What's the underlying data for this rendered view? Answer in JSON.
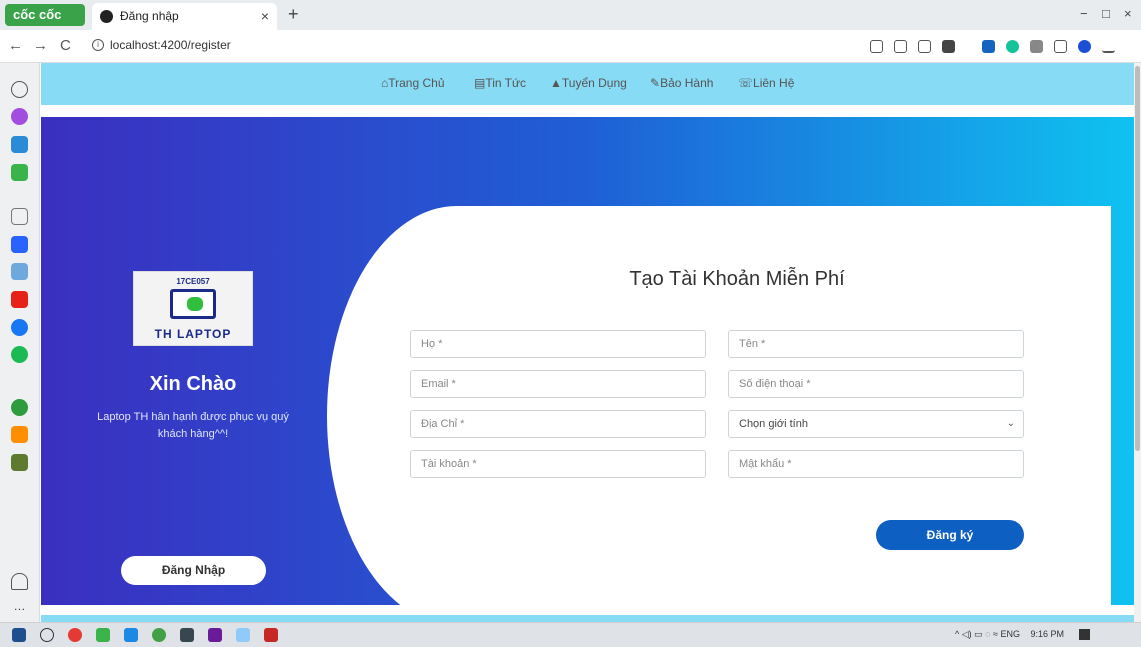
{
  "browser": {
    "brand": "cốc cốc",
    "tab_title": "Đăng nhập",
    "tab_close": "×",
    "new_tab": "+",
    "url": "localhost:4200/register",
    "nav": {
      "back": "←",
      "forward": "→",
      "reload": "C",
      "info": "i"
    },
    "window": {
      "minimize": "−",
      "maximize": "□",
      "close": "×"
    }
  },
  "topnav": {
    "items": [
      "Trang Chủ",
      "Tin Tức",
      "Tuyển Dụng",
      "Bảo Hành",
      "Liên Hệ"
    ]
  },
  "left_panel": {
    "logo_top": "17CE057",
    "logo_text": "TH LAPTOP",
    "greeting": "Xin Chào",
    "welcome": "Laptop TH hân hạnh được phục vụ quý khách hàng^^!",
    "login_button": "Đăng Nhập"
  },
  "form": {
    "title": "Tạo Tài Khoản Miễn Phí",
    "fields": {
      "last_name": "Họ *",
      "first_name": "Tên *",
      "email": "Email *",
      "phone": "Số điện thoại *",
      "address": "Địa Chỉ *",
      "gender": "Chọn giới tính",
      "username": "Tài khoản *",
      "password": "Mật khẩu *"
    },
    "submit": "Đăng ký"
  },
  "taskbar": {
    "tray_text": "ENG",
    "time": "9:16 PM"
  },
  "colors": {
    "nav_bg": "#87dbf5",
    "gradient_start": "#3b2fc0",
    "gradient_end": "#0fc2f0",
    "submit_bg": "#0d5fc2"
  }
}
